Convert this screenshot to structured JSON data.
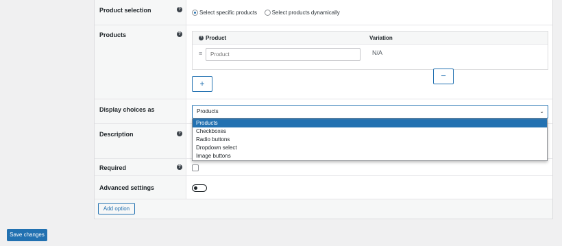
{
  "rows": {
    "product_selection": {
      "label": "Product selection",
      "options": [
        "Select specific products",
        "Select products dynamically"
      ],
      "selected": "Select specific products"
    },
    "products": {
      "label": "Products",
      "table": {
        "col_product": "Product",
        "col_variation": "Variation",
        "row_product_placeholder": "Product",
        "row_variation": "N/A"
      },
      "remove_label": "−",
      "add_label": "+"
    },
    "display_choices": {
      "label": "Display choices as",
      "selected": "Products",
      "options": [
        "Products",
        "Checkboxes",
        "Radio buttons",
        "Dropdown select",
        "Image buttons"
      ]
    },
    "description": {
      "label": "Description"
    },
    "required": {
      "label": "Required"
    },
    "advanced": {
      "label": "Advanced settings"
    }
  },
  "footer": {
    "add_option": "Add option"
  },
  "save_button": "Save changes",
  "colors": {
    "accent": "#2271b1",
    "background": "#f0f0f1"
  },
  "icons": {
    "help": "help-icon",
    "chevron": "chevron-down-icon",
    "drag": "drag-handle-icon"
  }
}
